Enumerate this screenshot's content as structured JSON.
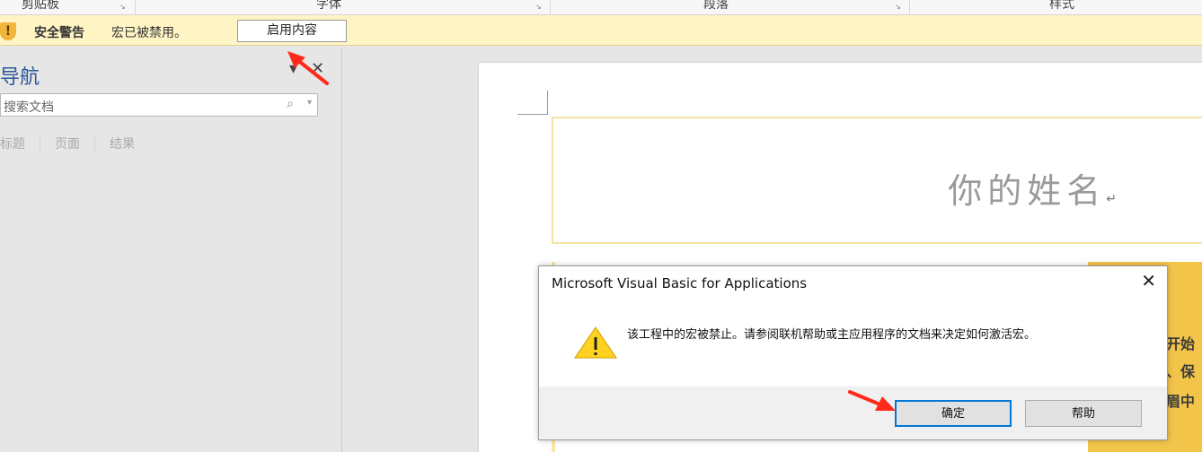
{
  "ribbon": {
    "groups": [
      "剪贴板",
      "字体",
      "段落",
      "样式"
    ],
    "launcher_glyph": "↘"
  },
  "security_bar": {
    "icon": "shield-warning-icon",
    "title": "安全警告",
    "message": "宏已被禁用。",
    "enable_button": "启用内容"
  },
  "navigation": {
    "title": "导航",
    "dropdown_glyph": "▾",
    "close_glyph": "✕",
    "search_placeholder": "搜索文档",
    "search_glyph": "⌕",
    "search_drop_glyph": "▾",
    "tabs": [
      "标题",
      "页面",
      "结果"
    ]
  },
  "document": {
    "name_placeholder": "你的姓名",
    "paragraph_mark": "↵",
    "side_text": [
      "开始",
      "、保",
      "眉中"
    ]
  },
  "dialog": {
    "title": "Microsoft Visual Basic for Applications",
    "close_glyph": "✕",
    "message": "该工程中的宏被禁止。请参阅联机帮助或主应用程序的文档来决定如何激活宏。",
    "ok_button": "确定",
    "help_button": "帮助",
    "icon": "warning-icon"
  },
  "colors": {
    "security_bar_bg": "#fff4c4",
    "nav_title": "#2b579a",
    "gold_panel": "#f3c44a",
    "focus_border": "#0078d7",
    "annotation_arrow": "#ff2a1a"
  }
}
